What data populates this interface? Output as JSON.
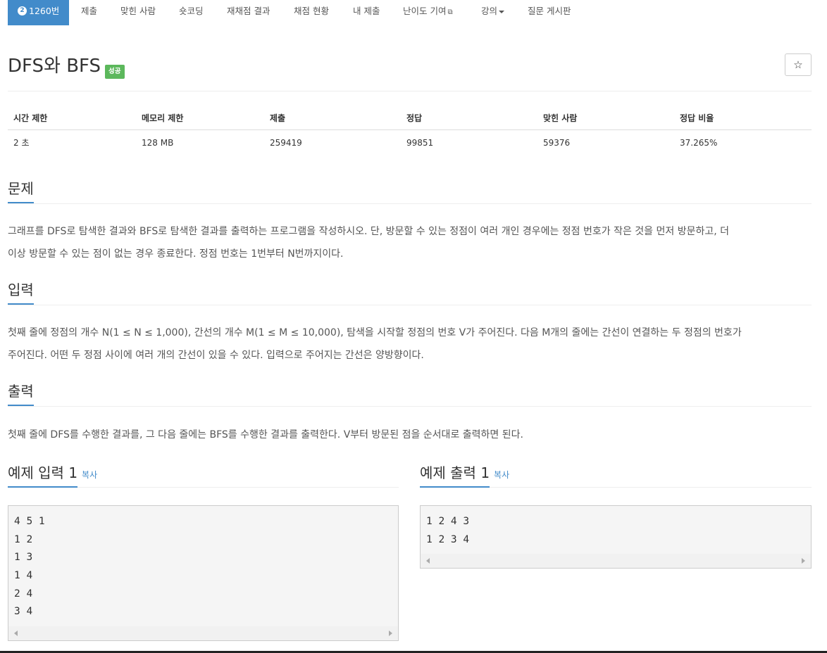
{
  "nav": {
    "problem_id": "1260번",
    "problem_badge": "2",
    "items": [
      {
        "label": "제출"
      },
      {
        "label": "맞힌 사람"
      },
      {
        "label": "숏코딩"
      },
      {
        "label": "재채점 결과"
      },
      {
        "label": "채점 현황"
      },
      {
        "label": "내 제출"
      },
      {
        "label": "난이도 기여"
      },
      {
        "label": "강의"
      },
      {
        "label": "질문 게시판"
      }
    ],
    "accent_color": "#428bca"
  },
  "problem": {
    "title": "DFS와 BFS",
    "status_label": "성공",
    "status_color": "#5cb85c",
    "star_icon": "star-outline-icon"
  },
  "info_table": {
    "headers": [
      "시간 제한",
      "메모리 제한",
      "제출",
      "정답",
      "맞힌 사람",
      "정답 비율"
    ],
    "values": [
      "2 초",
      "128 MB",
      "259419",
      "99851",
      "59376",
      "37.265%"
    ]
  },
  "sections": {
    "description": {
      "title": "문제",
      "lines": [
        "그래프를 DFS로 탐색한 결과와 BFS로 탐색한 결과를 출력하는 프로그램을 작성하시오. 단, 방문할 수 있는 정점이 여러 개인 경우에는 정점 번호가 작은 것을 먼저 방문하고, 더",
        "이상 방문할 수 있는 점이 없는 경우 종료한다. 정점 번호는 1번부터 N번까지이다."
      ]
    },
    "input": {
      "title": "입력",
      "lines": [
        "첫째 줄에 정점의 개수 N(1 ≤ N ≤ 1,000), 간선의 개수 M(1 ≤ M ≤ 10,000), 탐색을 시작할 정점의 번호 V가 주어진다. 다음 M개의 줄에는 간선이 연결하는 두 정점의 번호가",
        "주어진다. 어떤 두 정점 사이에 여러 개의 간선이 있을 수 있다. 입력으로 주어지는 간선은 양방향이다."
      ]
    },
    "output": {
      "title": "출력",
      "lines": [
        "첫째 줄에 DFS를 수행한 결과를, 그 다음 줄에는 BFS를 수행한 결과를 출력한다. V부터 방문된 점을 순서대로 출력하면 된다."
      ]
    }
  },
  "samples": {
    "input": {
      "title": "예제 입력 1",
      "copy_label": "복사",
      "lines": [
        "4 5 1",
        "1 2",
        "1 3",
        "1 4",
        "2 4",
        "3 4"
      ]
    },
    "output": {
      "title": "예제 출력 1",
      "copy_label": "복사",
      "lines": [
        "1 2 4 3",
        "1 2 3 4"
      ]
    }
  }
}
